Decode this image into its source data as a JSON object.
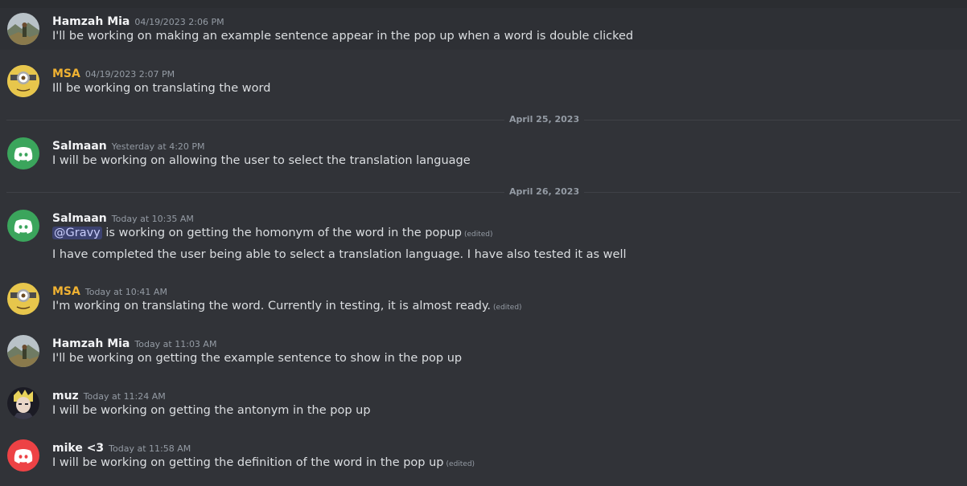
{
  "dividers": [
    "April 25, 2023",
    "April 26, 2023"
  ],
  "messages": [
    {
      "author": "Hamzah Mia",
      "author_color": "#f2f3f5",
      "timestamp": "04/19/2023 2:06 PM",
      "avatar": "landscape-photo-avatar",
      "lines": [
        "I'll be working on making an example sentence appear in the pop up when a word is double clicked"
      ]
    },
    {
      "author": "MSA",
      "author_color": "#f0b232",
      "timestamp": "04/19/2023 2:07 PM",
      "avatar": "minion-avatar",
      "lines": [
        "Ill be working on translating the word"
      ]
    },
    {
      "author": "Salmaan",
      "author_color": "#f2f3f5",
      "timestamp": "Yesterday at 4:20 PM",
      "avatar": "discord-default-green-avatar",
      "lines": [
        "I will be working on allowing the user to select the translation language"
      ]
    },
    {
      "author": "Salmaan",
      "author_color": "#f2f3f5",
      "timestamp": "Today at 10:35 AM",
      "avatar": "discord-default-green-avatar",
      "mention": "@Gravy",
      "lines": [
        " is working on getting the homonym of the word in the popup",
        "I have completed the user being able to select a translation language. I have also tested it as well"
      ],
      "edited": "(edited)"
    },
    {
      "author": "MSA",
      "author_color": "#f0b232",
      "timestamp": "Today at 10:41 AM",
      "avatar": "minion-avatar",
      "lines": [
        "I'm working on translating the word. Currently in testing, it is almost ready."
      ],
      "edited": "(edited)"
    },
    {
      "author": "Hamzah Mia",
      "author_color": "#f2f3f5",
      "timestamp": "Today at 11:03 AM",
      "avatar": "landscape-photo-avatar",
      "lines": [
        "I'll be working on getting the example sentence to show in the pop up"
      ]
    },
    {
      "author": "muz",
      "author_color": "#f2f3f5",
      "timestamp": "Today at 11:24 AM",
      "avatar": "anime-character-avatar",
      "lines": [
        "I will be working on getting the antonym in the pop up"
      ]
    },
    {
      "author": "mike <3",
      "author_color": "#f2f3f5",
      "timestamp": "Today at 11:58 AM",
      "avatar": "discord-default-red-avatar",
      "lines": [
        "I will be working on getting the definition of the word in the pop up"
      ],
      "edited": "(edited)"
    }
  ]
}
